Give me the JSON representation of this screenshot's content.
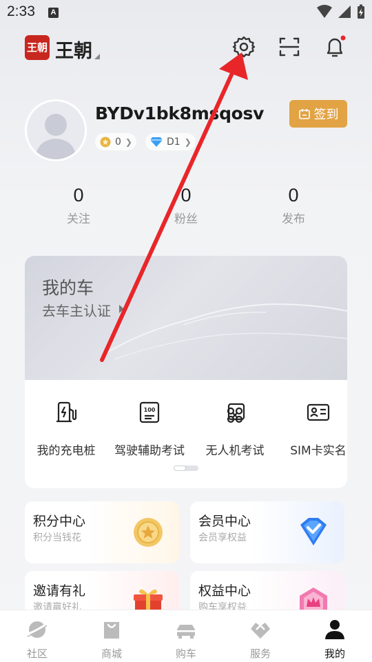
{
  "status_bar": {
    "time": "2:33",
    "notification_icon": "A"
  },
  "header": {
    "logo_text": "王朝",
    "brand_name": "王朝",
    "icons": [
      "settings-icon",
      "scan-icon",
      "bell-icon"
    ]
  },
  "profile": {
    "username": "BYDv1bk8msqosv",
    "points_badge": "0",
    "level_badge": "D1",
    "checkin_label": "签到"
  },
  "stats": [
    {
      "value": "0",
      "label": "关注"
    },
    {
      "value": "0",
      "label": "粉丝"
    },
    {
      "value": "0",
      "label": "发布"
    }
  ],
  "car_card": {
    "title": "我的车",
    "subtitle": "去车主认证",
    "services": [
      {
        "label": "我的充电桩",
        "icon": "charging-pile-icon"
      },
      {
        "label": "驾驶辅助考试",
        "icon": "exam-icon"
      },
      {
        "label": "无人机考试",
        "icon": "drone-icon"
      },
      {
        "label": "SIM卡实名",
        "icon": "id-card-icon"
      }
    ]
  },
  "benefit_cards": [
    {
      "title": "积分中心",
      "subtitle": "积分当钱花",
      "icon": "coin-icon"
    },
    {
      "title": "会员中心",
      "subtitle": "会员享权益",
      "icon": "diamond-icon"
    },
    {
      "title": "邀请有礼",
      "subtitle": "邀请赢好礼",
      "icon": "gift-icon"
    },
    {
      "title": "权益中心",
      "subtitle": "购车享权益",
      "icon": "crown-badge-icon"
    }
  ],
  "bottom_nav": [
    {
      "label": "社区",
      "icon": "planet-icon",
      "active": false
    },
    {
      "label": "商城",
      "icon": "shopping-bag-icon",
      "active": false
    },
    {
      "label": "购车",
      "icon": "car-icon",
      "active": false
    },
    {
      "label": "服务",
      "icon": "service-icon",
      "active": false
    },
    {
      "label": "我的",
      "icon": "person-icon",
      "active": true
    }
  ],
  "colors": {
    "accent": "#e2a344",
    "brand_red": "#c8271f",
    "annotation_red": "#e8262a"
  }
}
